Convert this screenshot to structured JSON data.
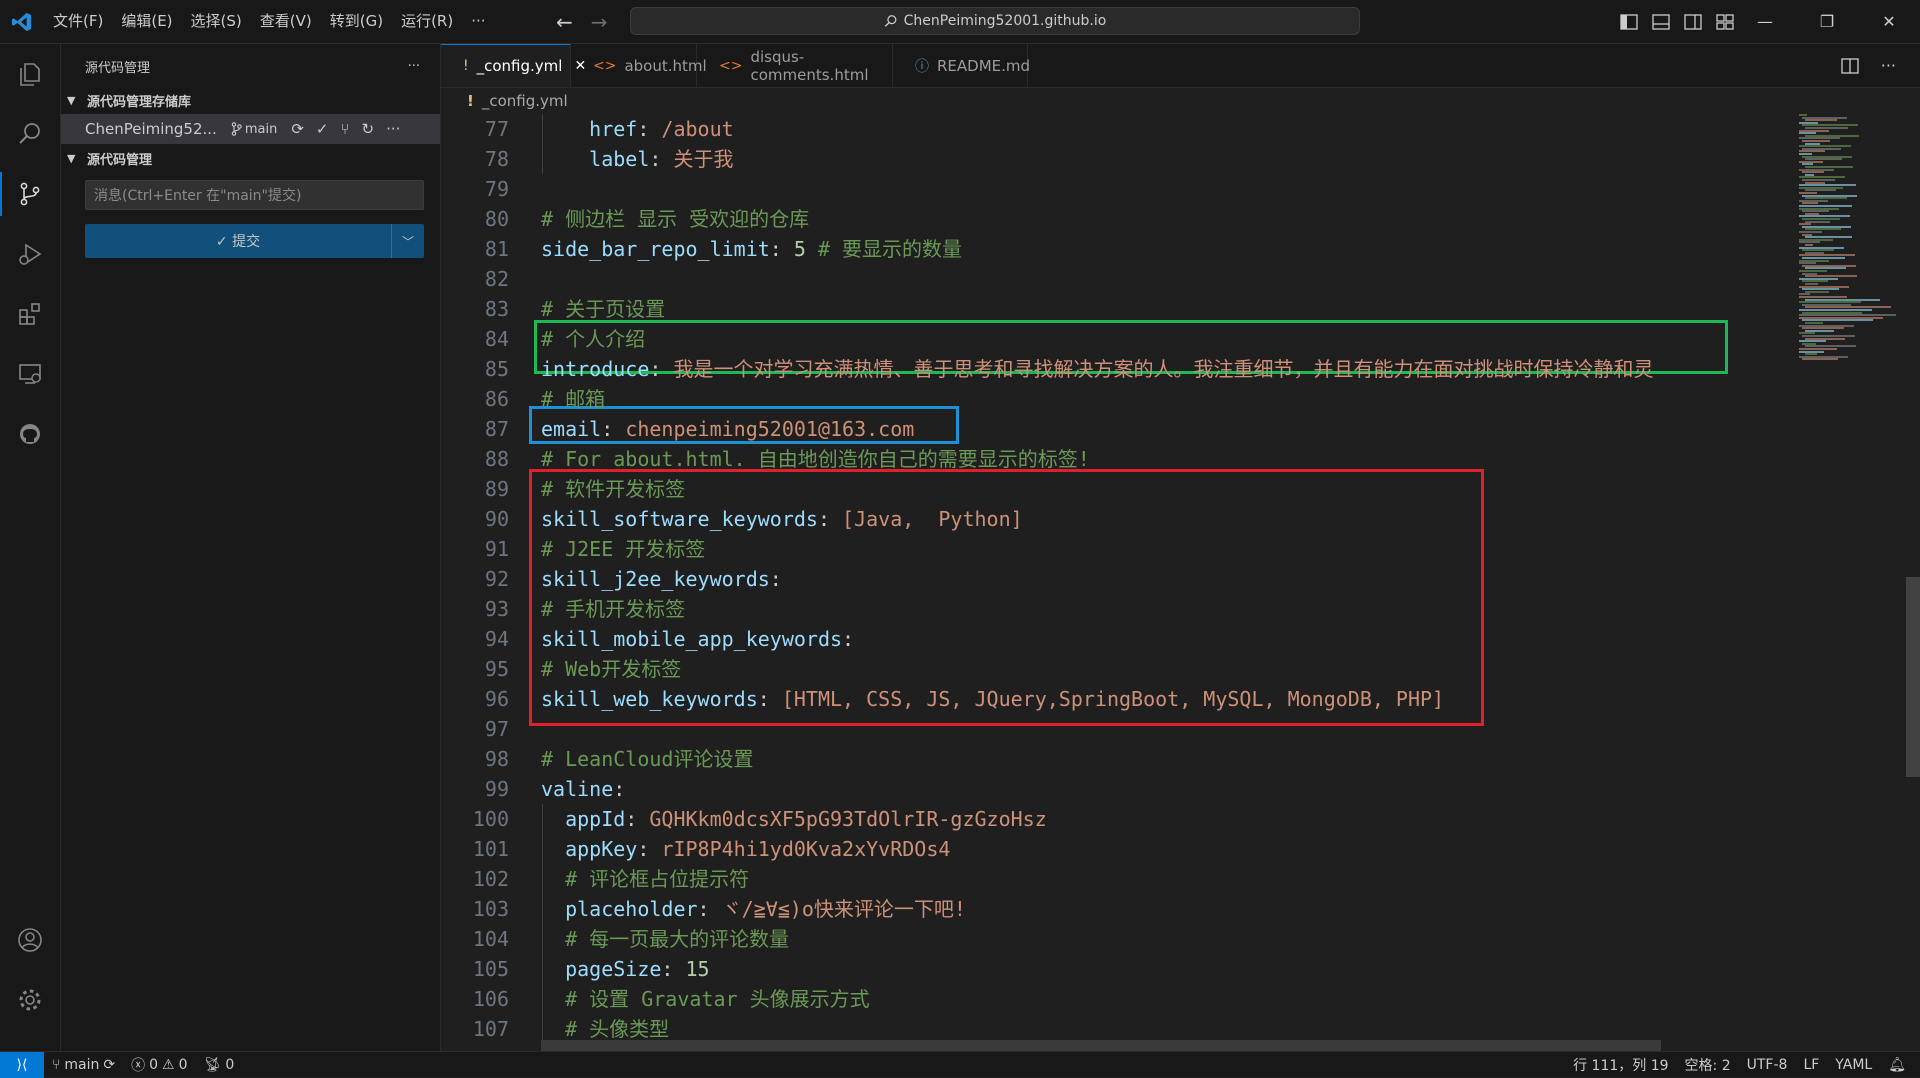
{
  "window": {
    "search_text": "ChenPeiming52001.github.io",
    "menu": [
      "文件(F)",
      "编辑(E)",
      "选择(S)",
      "查看(V)",
      "转到(G)",
      "运行(R)",
      "···"
    ]
  },
  "sidebar": {
    "title": "源代码管理",
    "more": "···",
    "repos_section": "源代码管理存储库",
    "repo_name": "ChenPeiming52...",
    "branch": "main",
    "scm_section": "源代码管理",
    "message_placeholder": "消息(Ctrl+Enter 在\"main\"提交)",
    "commit_label": "✓ 提交"
  },
  "tabs": [
    {
      "label": "_config.yml",
      "icon": "!",
      "active": true
    },
    {
      "label": "about.html",
      "icon": "<>"
    },
    {
      "label": "disqus-comments.html",
      "icon": "<>"
    },
    {
      "label": "README.md",
      "icon": "ⓘ"
    }
  ],
  "breadcrumb": {
    "icon": "!",
    "file": "_config.yml"
  },
  "editor": {
    "lines": [
      {
        "n": "77",
        "parts": [
          [
            "k",
            "    href"
          ],
          [
            "p",
            ": "
          ],
          [
            "v",
            "/about"
          ]
        ]
      },
      {
        "n": "78",
        "parts": [
          [
            "k",
            "    label"
          ],
          [
            "p",
            ": "
          ],
          [
            "v",
            "关于我"
          ]
        ]
      },
      {
        "n": "79",
        "parts": []
      },
      {
        "n": "80",
        "parts": [
          [
            "c",
            "# 侧边栏 显示 受欢迎的仓库"
          ]
        ]
      },
      {
        "n": "81",
        "parts": [
          [
            "k",
            "side_bar_repo_limit"
          ],
          [
            "p",
            ": "
          ],
          [
            "n",
            "5"
          ],
          [
            "c",
            " # 要显示的数量"
          ]
        ]
      },
      {
        "n": "82",
        "parts": []
      },
      {
        "n": "83",
        "parts": [
          [
            "c",
            "# 关于页设置"
          ]
        ]
      },
      {
        "n": "84",
        "parts": [
          [
            "c",
            "# 个人介绍"
          ]
        ]
      },
      {
        "n": "85",
        "parts": [
          [
            "k",
            "introduce"
          ],
          [
            "p",
            ": "
          ],
          [
            "v",
            "我是一个对学习充满热情、善于思考和寻找解决方案的人。我注重细节，并且有能力在面对挑战时保持冷静和灵"
          ]
        ]
      },
      {
        "n": "86",
        "parts": [
          [
            "c",
            "# 邮箱"
          ]
        ]
      },
      {
        "n": "87",
        "parts": [
          [
            "k",
            "email"
          ],
          [
            "p",
            ": "
          ],
          [
            "v",
            "chenpeiming52001@163.com"
          ]
        ]
      },
      {
        "n": "88",
        "parts": [
          [
            "c",
            "# For about.html. 自由地创造你自己的需要显示的标签!"
          ]
        ]
      },
      {
        "n": "89",
        "parts": [
          [
            "c",
            "# 软件开发标签"
          ]
        ]
      },
      {
        "n": "90",
        "parts": [
          [
            "k",
            "skill_software_keywords"
          ],
          [
            "p",
            ": "
          ],
          [
            "v",
            "[Java,  Python]"
          ]
        ]
      },
      {
        "n": "91",
        "parts": [
          [
            "c",
            "# J2EE 开发标签"
          ]
        ]
      },
      {
        "n": "92",
        "parts": [
          [
            "k",
            "skill_j2ee_keywords"
          ],
          [
            "p",
            ":"
          ]
        ]
      },
      {
        "n": "93",
        "parts": [
          [
            "c",
            "# 手机开发标签"
          ]
        ]
      },
      {
        "n": "94",
        "parts": [
          [
            "k",
            "skill_mobile_app_keywords"
          ],
          [
            "p",
            ":"
          ]
        ]
      },
      {
        "n": "95",
        "parts": [
          [
            "c",
            "# Web开发标签"
          ]
        ]
      },
      {
        "n": "96",
        "parts": [
          [
            "k",
            "skill_web_keywords"
          ],
          [
            "p",
            ": "
          ],
          [
            "v",
            "[HTML, CSS, JS, JQuery,SpringBoot, MySQL, MongoDB, PHP]"
          ]
        ]
      },
      {
        "n": "97",
        "parts": []
      },
      {
        "n": "98",
        "parts": [
          [
            "c",
            "# LeanCloud评论设置"
          ]
        ]
      },
      {
        "n": "99",
        "parts": [
          [
            "k",
            "valine"
          ],
          [
            "p",
            ":"
          ]
        ]
      },
      {
        "n": "100",
        "parts": [
          [
            "k",
            "  appId"
          ],
          [
            "p",
            ": "
          ],
          [
            "v",
            "GQHKkm0dcsXF5pG93TdOlrIR-gzGzoHsz"
          ]
        ]
      },
      {
        "n": "101",
        "parts": [
          [
            "k",
            "  appKey"
          ],
          [
            "p",
            ": "
          ],
          [
            "v",
            "rIP8P4hi1yd0Kva2xYvRDOs4"
          ]
        ]
      },
      {
        "n": "102",
        "parts": [
          [
            "c",
            "  # 评论框占位提示符"
          ]
        ]
      },
      {
        "n": "103",
        "parts": [
          [
            "k",
            "  placeholder"
          ],
          [
            "p",
            ": "
          ],
          [
            "v",
            "ヾ/≧∀≦)o快来评论一下吧!"
          ]
        ]
      },
      {
        "n": "104",
        "parts": [
          [
            "c",
            "  # 每一页最大的评论数量"
          ]
        ]
      },
      {
        "n": "105",
        "parts": [
          [
            "k",
            "  pageSize"
          ],
          [
            "p",
            ": "
          ],
          [
            "n",
            "15"
          ]
        ]
      },
      {
        "n": "106",
        "parts": [
          [
            "c",
            "  # 设置 Gravatar 头像展示方式"
          ]
        ]
      },
      {
        "n": "107",
        "parts": [
          [
            "c",
            "  # 头像类型"
          ]
        ]
      }
    ]
  },
  "highlights": {
    "green": "#1db954",
    "blue": "#1e90d6",
    "red": "#e0202a"
  },
  "statusbar": {
    "branch": "main",
    "errors": "0",
    "warnings": "0",
    "ports": "0",
    "position": "行 111，列 19",
    "spaces": "空格: 2",
    "encoding": "UTF-8",
    "eol": "LF",
    "language": "YAML"
  }
}
